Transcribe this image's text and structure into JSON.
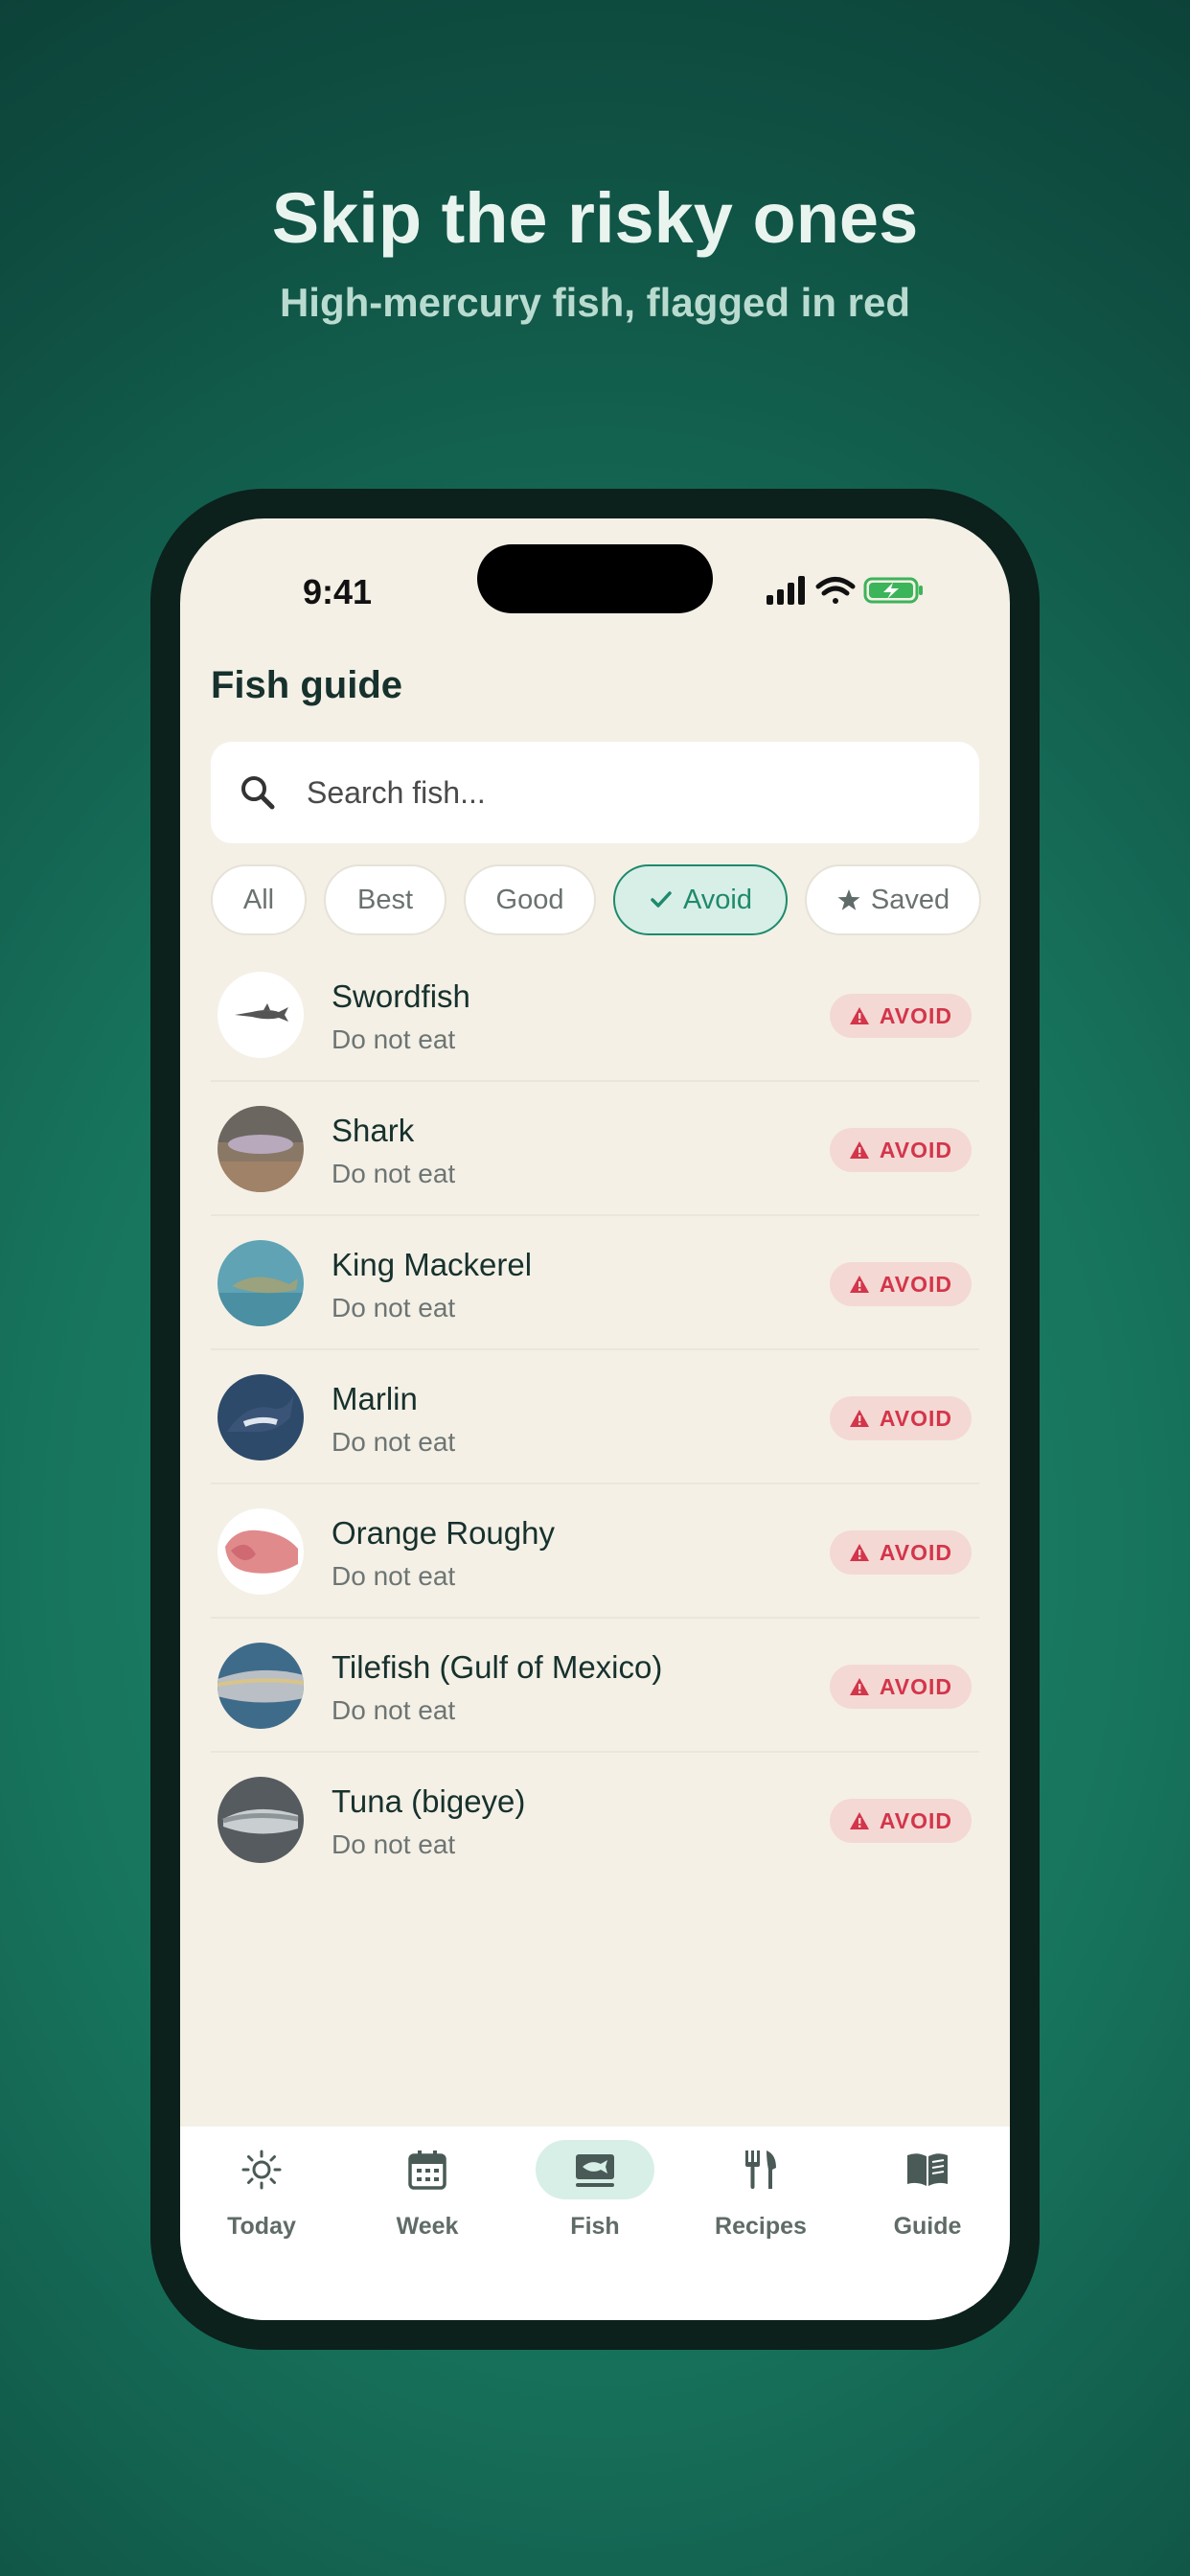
{
  "promo": {
    "headline": "Skip the risky ones",
    "subhead": "High-mercury fish, flagged in red"
  },
  "status_bar": {
    "time": "9:41"
  },
  "page": {
    "title": "Fish guide"
  },
  "search": {
    "placeholder": "Search fish..."
  },
  "filters": {
    "all": "All",
    "best": "Best",
    "good": "Good",
    "avoid": "Avoid",
    "saved": "Saved",
    "active": "Avoid"
  },
  "fish_list": [
    {
      "name": "Swordfish",
      "status": "Do not eat",
      "badge": "AVOID",
      "icon": "swordfish-photo"
    },
    {
      "name": "Shark",
      "status": "Do not eat",
      "badge": "AVOID",
      "icon": "shark-photo"
    },
    {
      "name": "King Mackerel",
      "status": "Do not eat",
      "badge": "AVOID",
      "icon": "king-mackerel-photo"
    },
    {
      "name": "Marlin",
      "status": "Do not eat",
      "badge": "AVOID",
      "icon": "marlin-photo"
    },
    {
      "name": "Orange Roughy",
      "status": "Do not eat",
      "badge": "AVOID",
      "icon": "orange-roughy-photo"
    },
    {
      "name": "Tilefish (Gulf of Mexico)",
      "status": "Do not eat",
      "badge": "AVOID",
      "icon": "tilefish-photo"
    },
    {
      "name": "Tuna (bigeye)",
      "status": "Do not eat",
      "badge": "AVOID",
      "icon": "tuna-photo"
    }
  ],
  "tabs": {
    "today": "Today",
    "week": "Week",
    "fish": "Fish",
    "recipes": "Recipes",
    "guide": "Guide",
    "active": "Fish"
  },
  "colors": {
    "accent": "#1e8a6c",
    "avoid": "#d3354a",
    "background": "#f4f0e6"
  }
}
